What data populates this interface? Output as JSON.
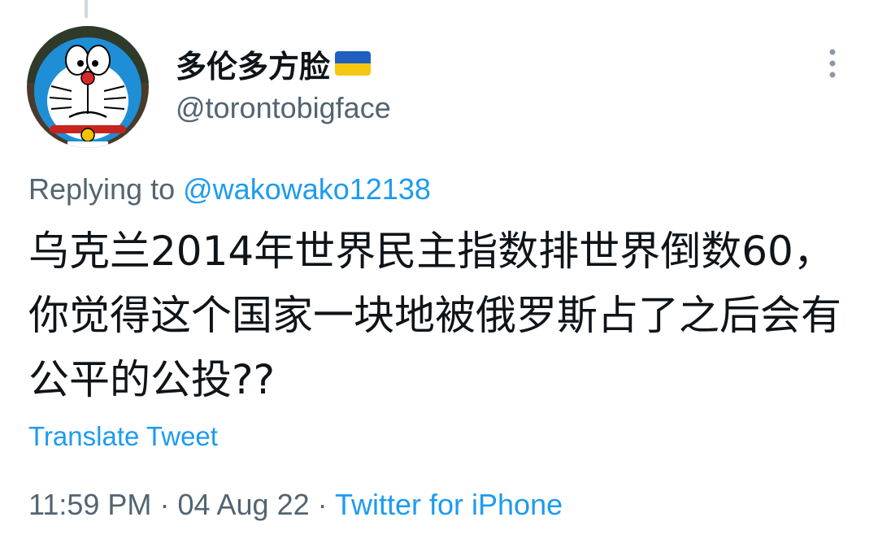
{
  "author": {
    "display_name": "多伦多方脸",
    "flag": "ukraine-flag",
    "handle": "@torontobigface"
  },
  "reply": {
    "prefix": "Replying to",
    "mention": "@wakowako12138"
  },
  "tweet": {
    "text": "乌克兰2014年世界民主指数排世界倒数60，你觉得这个国家一块地被俄罗斯占了之后会有公平的公投??"
  },
  "translate_label": "Translate Tweet",
  "meta": {
    "time": "11:59 PM",
    "separator": "·",
    "date": "04 Aug 22",
    "source": "Twitter for iPhone"
  },
  "colors": {
    "link": "#1d9bf0",
    "secondary_text": "#536471",
    "primary_text": "#0f1419",
    "flag_blue": "#1f5fbf",
    "flag_yellow": "#f6c711"
  }
}
